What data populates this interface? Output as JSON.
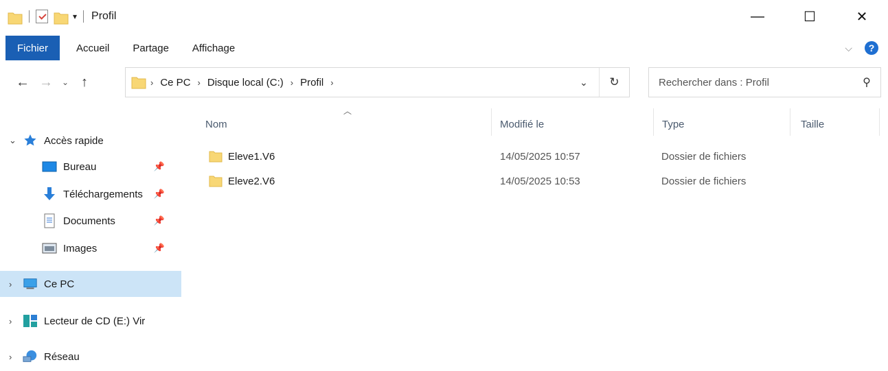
{
  "window": {
    "title": "Profil",
    "controls": {
      "minimize": "—",
      "maximize": "☐",
      "close": "✕"
    }
  },
  "ribbon": {
    "tabs": [
      "Fichier",
      "Accueil",
      "Partage",
      "Affichage"
    ],
    "help_label": "?"
  },
  "address": {
    "crumbs": [
      "Ce PC",
      "Disque local (C:)",
      "Profil"
    ]
  },
  "search": {
    "placeholder": "Rechercher dans : Profil"
  },
  "sidebar": {
    "items": [
      {
        "label": "Accès rapide",
        "icon": "star-icon"
      },
      {
        "label": "Bureau",
        "icon": "desktop-icon"
      },
      {
        "label": "Téléchargements",
        "icon": "download-icon"
      },
      {
        "label": "Documents",
        "icon": "document-icon"
      },
      {
        "label": "Images",
        "icon": "images-icon"
      },
      {
        "label": "Ce PC",
        "icon": "computer-icon"
      },
      {
        "label": "Lecteur de CD (E:) Vir",
        "icon": "cd-drive-icon"
      },
      {
        "label": "Réseau",
        "icon": "network-icon"
      }
    ]
  },
  "content": {
    "columns": {
      "name": "Nom",
      "modified": "Modifié le",
      "type": "Type",
      "size": "Taille"
    },
    "rows": [
      {
        "name": "Eleve1.V6",
        "modified": "14/05/2025 10:57",
        "type": "Dossier de fichiers",
        "size": ""
      },
      {
        "name": "Eleve2.V6",
        "modified": "14/05/2025 10:53",
        "type": "Dossier de fichiers",
        "size": ""
      }
    ]
  },
  "colors": {
    "accent": "#1a5fb4",
    "selection": "#cce4f7",
    "folder": "#f8d775"
  }
}
